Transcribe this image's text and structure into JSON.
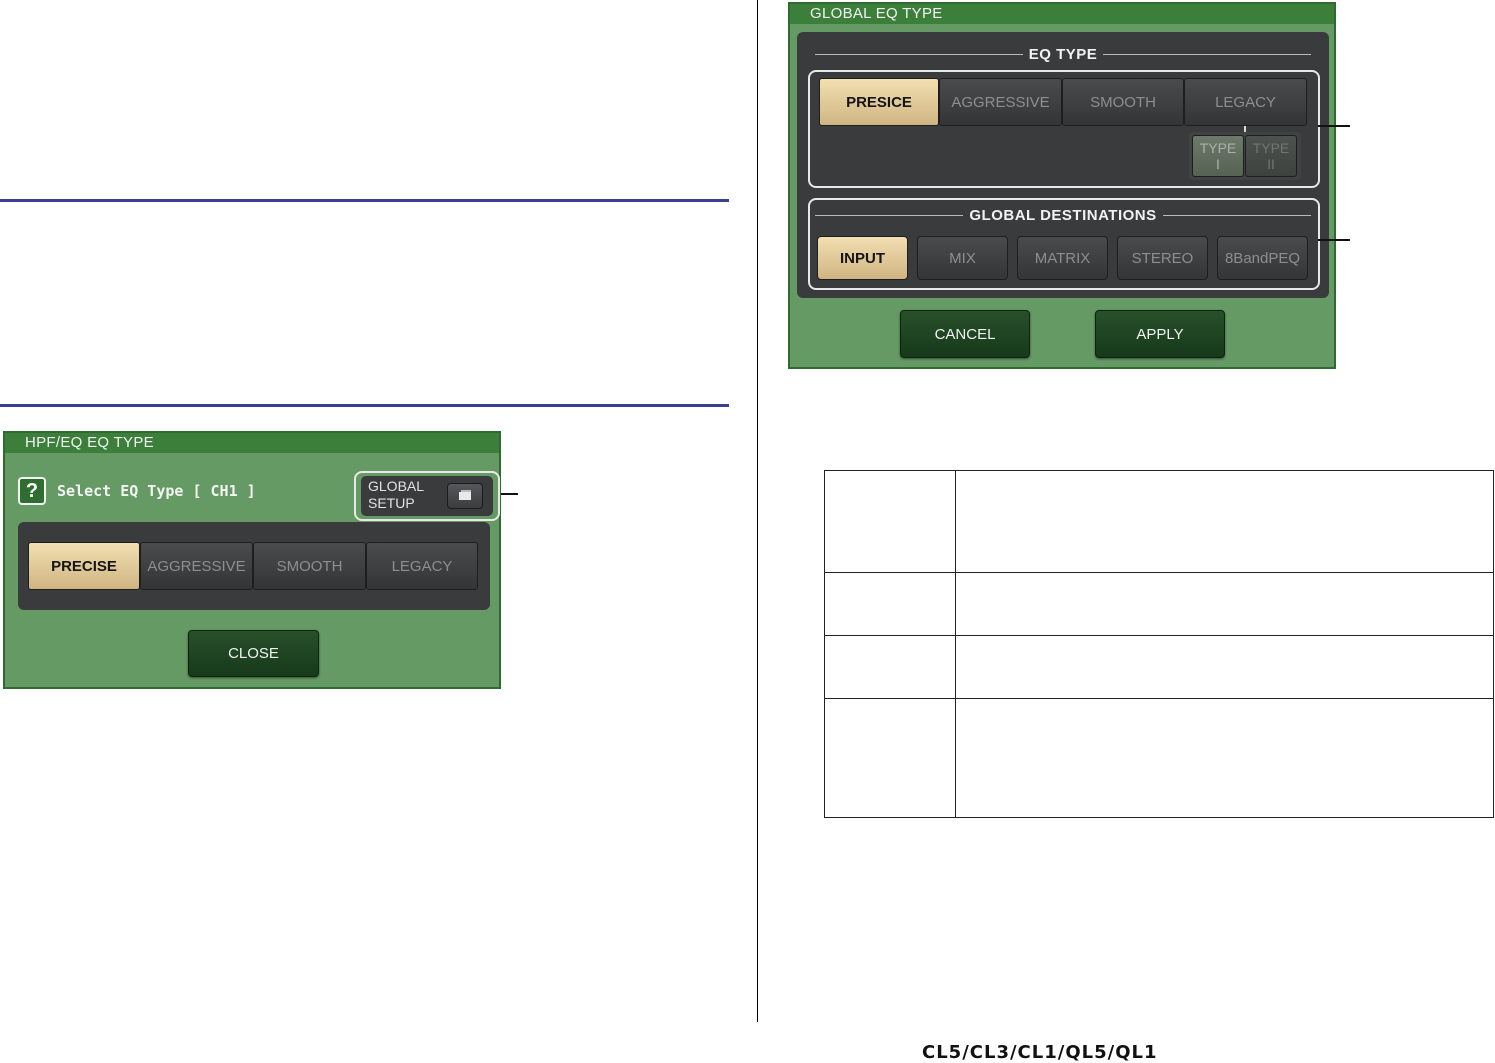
{
  "hpf_dialog": {
    "title": "HPF/EQ EQ TYPE",
    "help_glyph": "?",
    "prompt": "Select EQ Type [ CH1 ]",
    "global_setup_label_1": "GLOBAL",
    "global_setup_label_2": "SETUP",
    "eq_types": [
      "PRECISE",
      "AGGRESSIVE",
      "SMOOTH",
      "LEGACY"
    ],
    "selected_eq_type": "PRECISE",
    "close_label": "CLOSE"
  },
  "global_dialog": {
    "title": "GLOBAL EQ TYPE",
    "eq_type_heading": "EQ TYPE",
    "eq_types": [
      "PRESICE",
      "AGGRESSIVE",
      "SMOOTH",
      "LEGACY"
    ],
    "selected_eq_type": "PRESICE",
    "legacy_types": [
      {
        "line1": "TYPE",
        "line2": "I"
      },
      {
        "line1": "TYPE",
        "line2": "II"
      }
    ],
    "destinations_heading": "GLOBAL DESTINATIONS",
    "destinations": [
      "INPUT",
      "MIX",
      "MATRIX",
      "STEREO",
      "8BandPEQ"
    ],
    "selected_destination": "INPUT",
    "cancel_label": "CANCEL",
    "apply_label": "APPLY"
  },
  "footer": {
    "model_names": "CL5/CL3/CL1/QL5/QL1"
  }
}
